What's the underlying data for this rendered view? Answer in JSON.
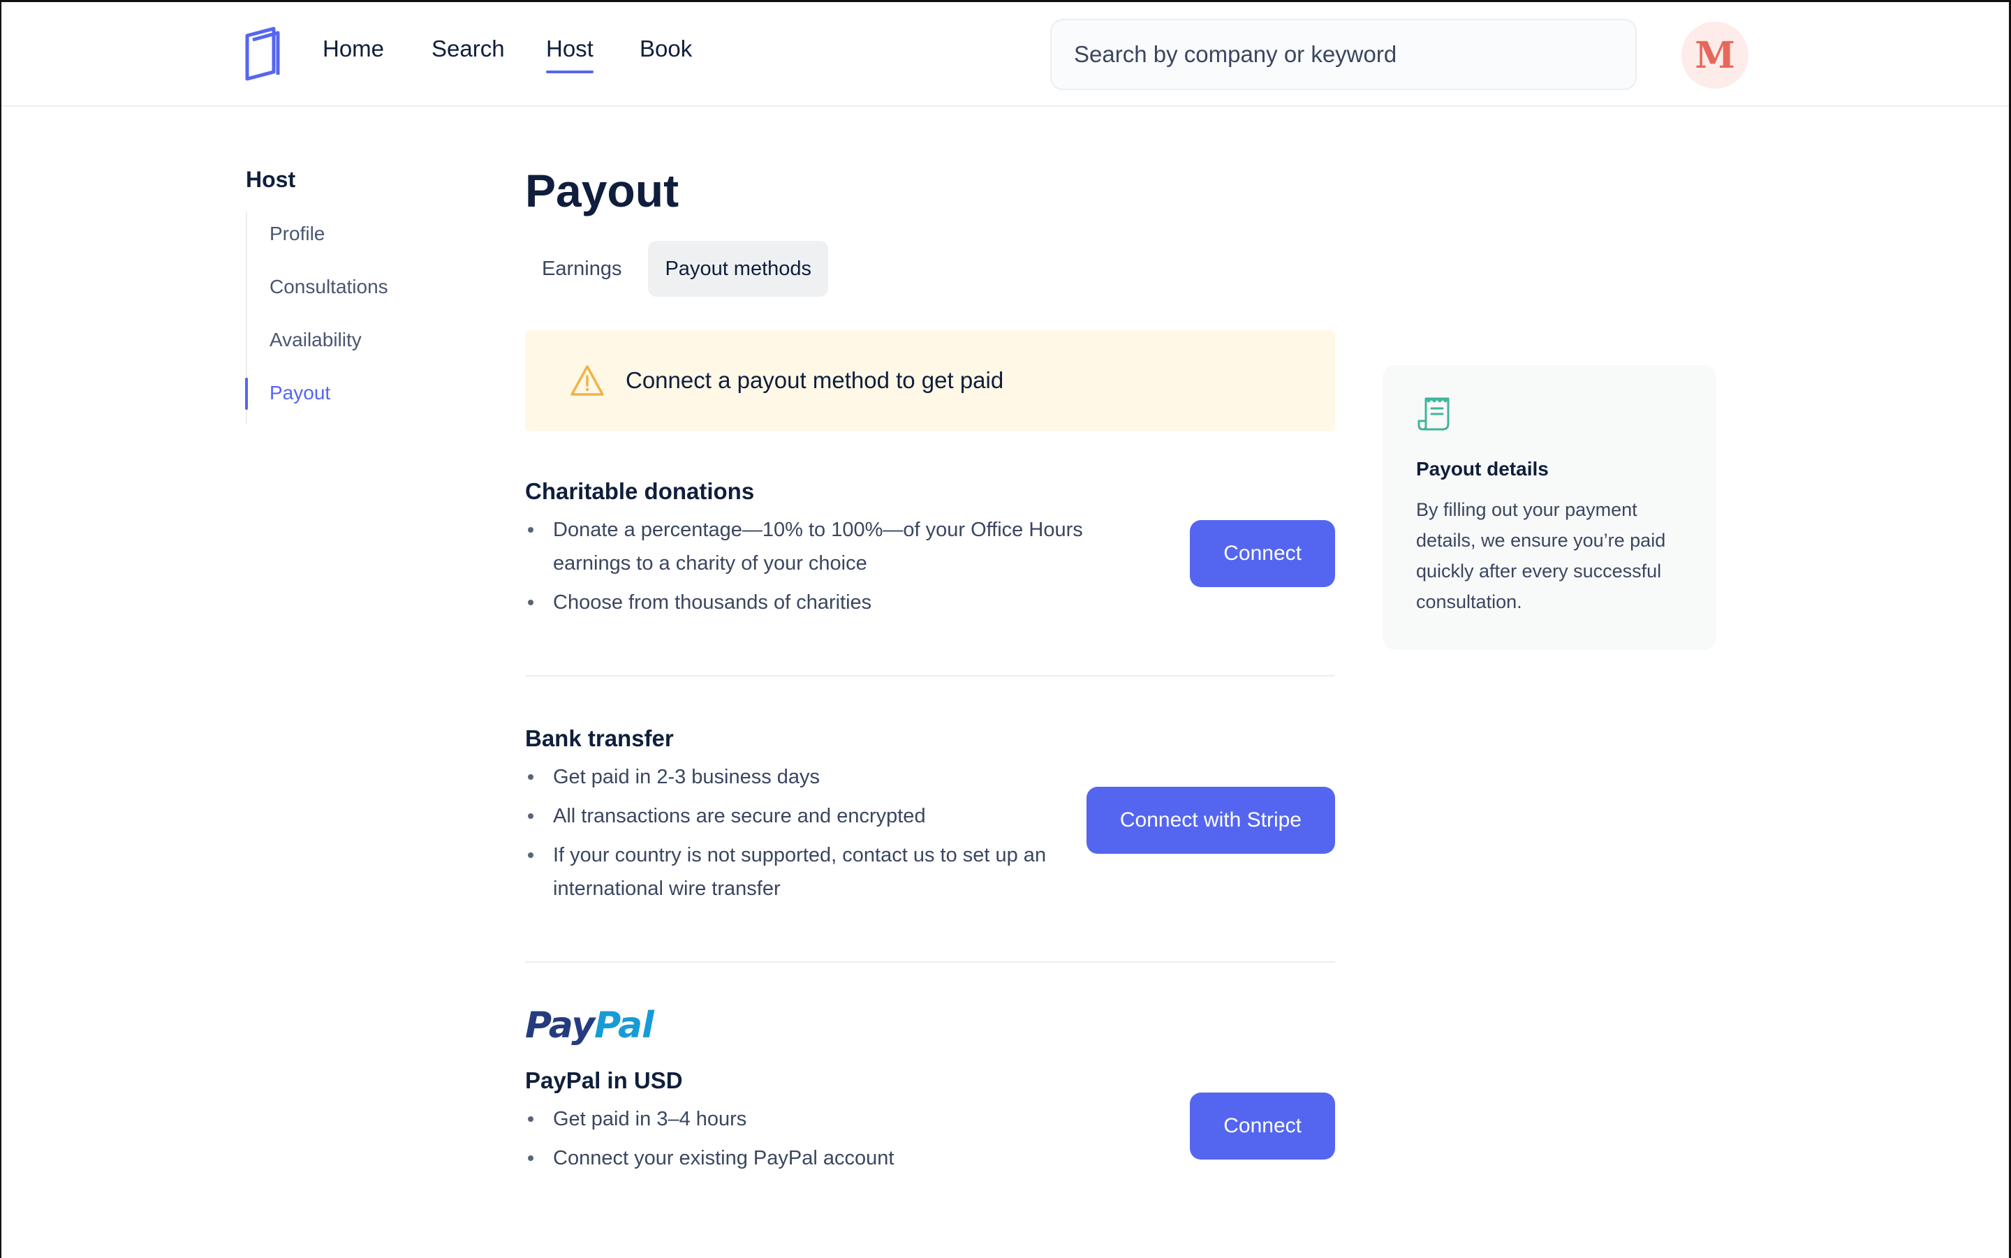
{
  "nav": {
    "items": [
      {
        "label": "Home"
      },
      {
        "label": "Search"
      },
      {
        "label": "Host"
      },
      {
        "label": "Book"
      }
    ],
    "search_placeholder": "Search by company or keyword",
    "avatar_letter": "M"
  },
  "sidebar": {
    "title": "Host",
    "items": [
      {
        "label": "Profile"
      },
      {
        "label": "Consultations"
      },
      {
        "label": "Availability"
      },
      {
        "label": "Payout"
      }
    ]
  },
  "main": {
    "title": "Payout",
    "tabs": [
      {
        "label": "Earnings"
      },
      {
        "label": "Payout methods"
      }
    ],
    "alert": "Connect a payout method to get paid",
    "sections": [
      {
        "title": "Charitable donations",
        "bullets": [
          "Donate a percentage—10% to 100%—of your Office Hours earnings to a charity of your choice",
          "Choose from thousands of charities"
        ],
        "button": "Connect"
      },
      {
        "title": "Bank transfer",
        "bullets": [
          "Get paid in 2-3 business days",
          "All transactions are secure and encrypted",
          "If your country is not supported, contact us to set up an international wire transfer"
        ],
        "button": "Connect with Stripe"
      },
      {
        "logo_pay": "Pay",
        "logo_pal": "Pal",
        "title": "PayPal in USD",
        "bullets": [
          "Get paid in 3–4 hours",
          "Connect your existing PayPal account"
        ],
        "button": "Connect"
      }
    ]
  },
  "info_card": {
    "title": "Payout details",
    "body": "By filling out your payment details, we ensure you’re paid quickly after every successful consultation."
  },
  "colors": {
    "accent": "#5466f0",
    "alert_bg": "#fff8e6",
    "warning": "#f0b34a",
    "receipt_icon": "#3fb59a",
    "avatar_text": "#e6685a"
  }
}
